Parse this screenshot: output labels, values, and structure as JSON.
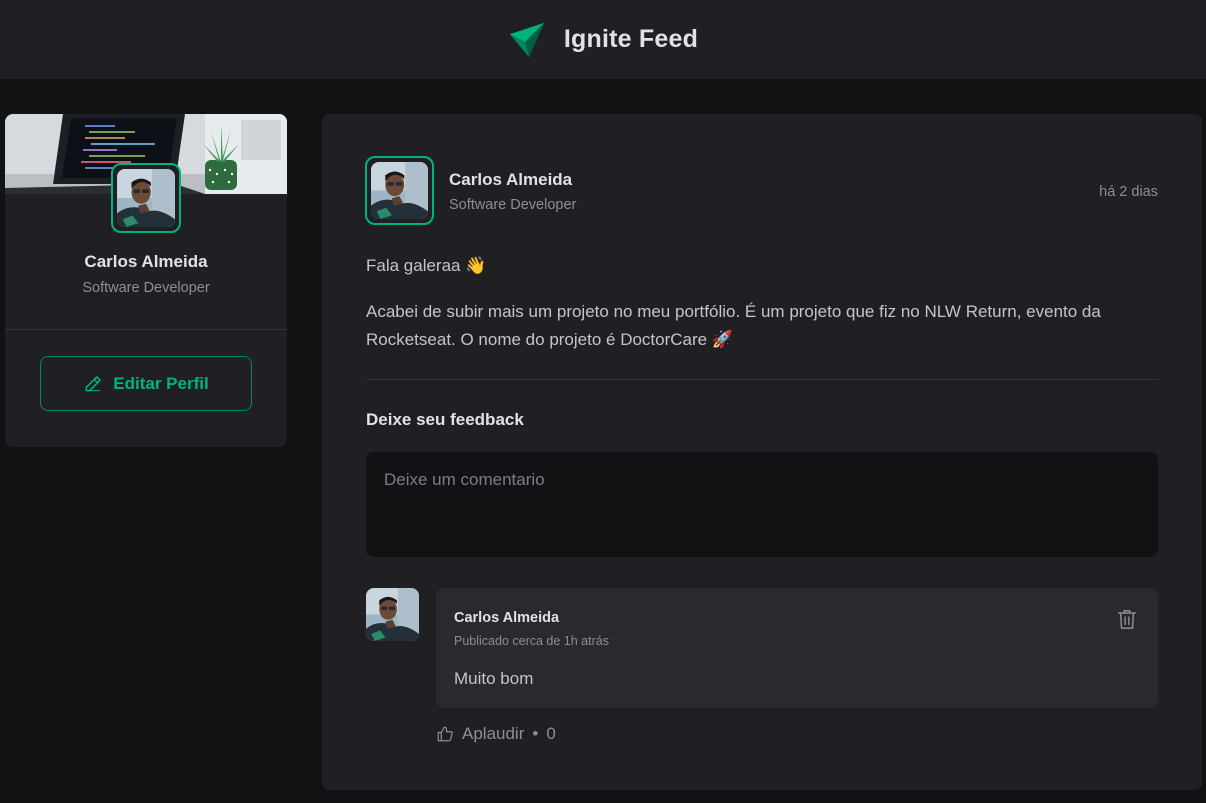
{
  "header": {
    "title": "Ignite Feed",
    "logo_icon": "ignite-logo-icon",
    "accent": "#00b37e"
  },
  "sidebar": {
    "name": "Carlos Almeida",
    "role": "Software Developer",
    "edit_button_label": "Editar Perfil",
    "edit_icon": "pencil-icon"
  },
  "post": {
    "author": "Carlos Almeida",
    "role": "Software Developer",
    "time": "há 2 dias",
    "paragraphs": [
      "Fala galeraa 👋",
      "Acabei de subir mais um projeto no meu portfólio. É um projeto que fiz no NLW Return, evento da Rocketseat. O nome do projeto é DoctorCare 🚀"
    ],
    "feedback_title": "Deixe seu feedback",
    "comment_placeholder": "Deixe um comentario"
  },
  "comment": {
    "author": "Carlos Almeida",
    "time": "Publicado cerca de 1h atrás",
    "text": "Muito bom",
    "delete_icon": "trash-icon",
    "applaud_label": "Aplaudir",
    "applaud_separator": "•",
    "applaud_count": "0",
    "applaud_icon": "thumbs-up-icon"
  }
}
